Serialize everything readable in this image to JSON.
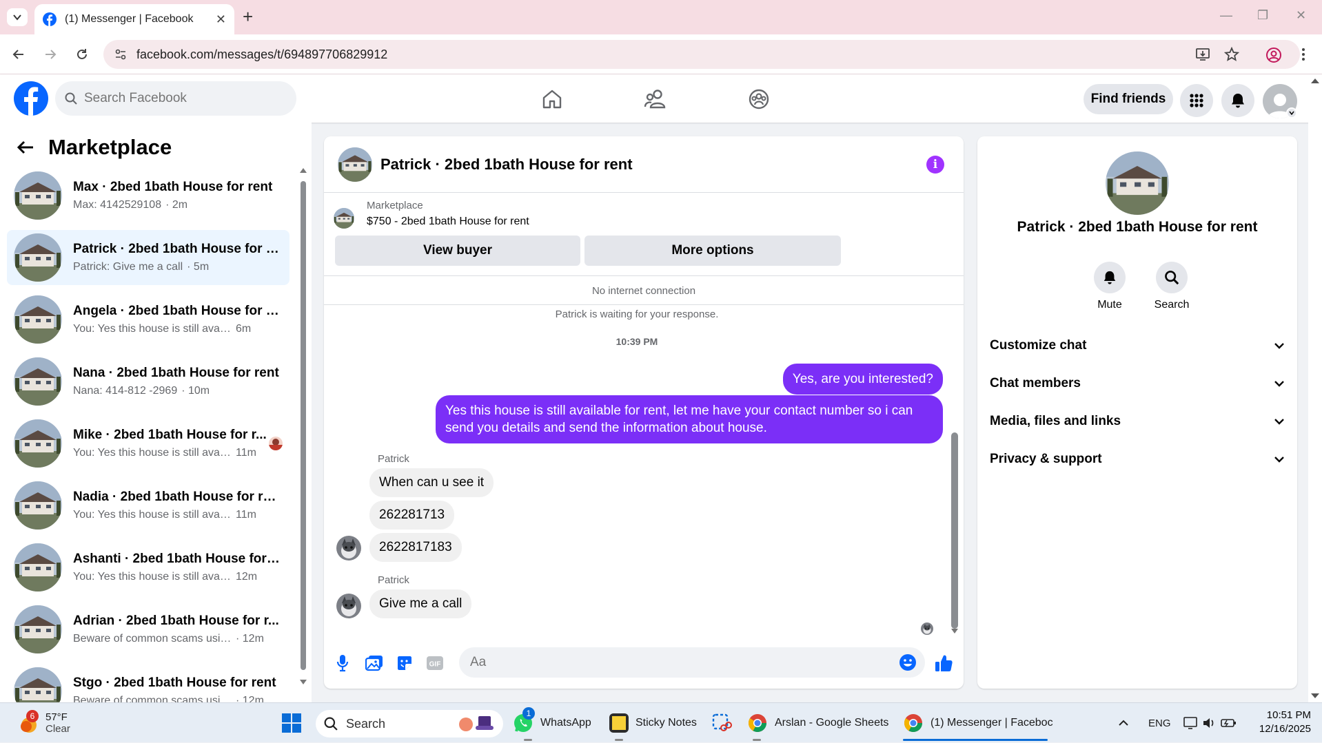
{
  "browser": {
    "tab_title": "(1) Messenger | Facebook",
    "url": "facebook.com/messages/t/694897706829912"
  },
  "fb_nav": {
    "search_placeholder": "Search Facebook",
    "find_friends": "Find friends"
  },
  "left": {
    "title": "Marketplace",
    "conversations": [
      {
        "name": "Max · 2bed 1bath House for rent",
        "preview": "Max: 4142529108",
        "time": "· 2m"
      },
      {
        "name": "Patrick · 2bed 1bath House for r...",
        "preview": "Patrick: Give me a call",
        "time": "· 5m"
      },
      {
        "name": "Angela · 2bed 1bath House for r...",
        "preview": "You: Yes this house is still available ...",
        "time": "6m"
      },
      {
        "name": "Nana · 2bed 1bath House for rent",
        "preview": "Nana: 414-812 -2969",
        "time": "· 10m"
      },
      {
        "name": "Mike · 2bed 1bath House for r...",
        "preview": "You: Yes this house is still avail...",
        "time": "11m"
      },
      {
        "name": "Nadia · 2bed 1bath House for rent",
        "preview": "You: Yes this house is still availabl...",
        "time": "11m"
      },
      {
        "name": "Ashanti · 2bed 1bath House for r...",
        "preview": "You: Yes this house is still availabl...",
        "time": "12m"
      },
      {
        "name": "Adrian · 2bed 1bath House for r...",
        "preview": "Beware of common scams using ...",
        "time": "· 12m"
      },
      {
        "name": "Stgo · 2bed 1bath House for rent",
        "preview": "Beware of common scams using ...",
        "time": "· 12m"
      }
    ]
  },
  "chat": {
    "header_name": "Patrick · 2bed 1bath House for rent",
    "marketplace_label": "Marketplace",
    "listing": "$750 - 2bed 1bath House for rent",
    "view_buyer": "View buyer",
    "more_options": "More options",
    "no_internet": "No internet connection",
    "waiting": "Patrick is waiting for your response.",
    "timestamp": "10:39 PM",
    "out_msg_1": "Yes, are you interested?",
    "out_msg_2": "Yes this house is still available for rent, let me have your contact number so i can send you details and send the information about house.",
    "sender": "Patrick",
    "in_msg_1": "When can u see it",
    "in_msg_2": "262281713",
    "in_msg_3": "2622817183",
    "in_msg_4": "Give me a call",
    "input_placeholder": "Aa"
  },
  "right": {
    "name": "Patrick · 2bed 1bath House for rent",
    "mute": "Mute",
    "search": "Search",
    "rows": [
      "Customize chat",
      "Chat members",
      "Media, files and links",
      "Privacy & support"
    ]
  },
  "taskbar": {
    "weather_temp": "57°F",
    "weather_desc": "Clear",
    "weather_badge": "6",
    "search": "Search",
    "whatsapp": "WhatsApp",
    "whatsapp_badge": "1",
    "sticky_notes": "Sticky Notes",
    "sheets": "Arslan - Google Sheets",
    "messenger": "(1) Messenger | Faceboc",
    "lang": "ENG",
    "time": "10:51 PM",
    "date": "12/16/2025"
  },
  "colors": {
    "fb_blue": "#0866ff",
    "outgoing_bubble": "#7b2ff7",
    "active_conv": "#ebf5ff"
  }
}
